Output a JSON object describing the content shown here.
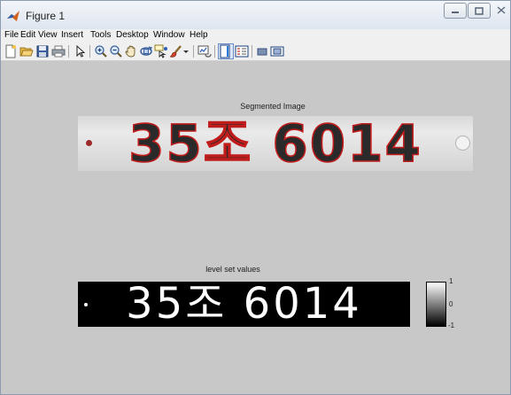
{
  "window": {
    "title": "Figure 1"
  },
  "menu": [
    "File",
    "Edit",
    "View",
    "Insert",
    "Tools",
    "Desktop",
    "Window",
    "Help"
  ],
  "toolbar": {
    "icons": [
      "new-figure-icon",
      "open-file-icon",
      "save-icon",
      "print-icon",
      "pointer-icon",
      "zoom-in-icon",
      "zoom-out-icon",
      "pan-icon",
      "rotate-3d-icon",
      "data-cursor-icon",
      "brush-icon",
      "brush-dropdown-icon",
      "link-plot-icon",
      "colorbar-icon",
      "legend-icon",
      "hide-plot-tools-icon",
      "show-plot-tools-icon"
    ]
  },
  "plots": {
    "segmented": {
      "title": "Segmented Image",
      "plate_text": "35조 6014"
    },
    "levelset": {
      "title": "level set values",
      "plate_text": "35조 6014"
    }
  },
  "colorbar": {
    "ticks": [
      "1",
      "0",
      "-1"
    ],
    "range": [
      -1,
      1
    ],
    "colormap": "gray"
  },
  "colors": {
    "figure_background": "#c8c8c8",
    "contour": "#c01c1c"
  }
}
